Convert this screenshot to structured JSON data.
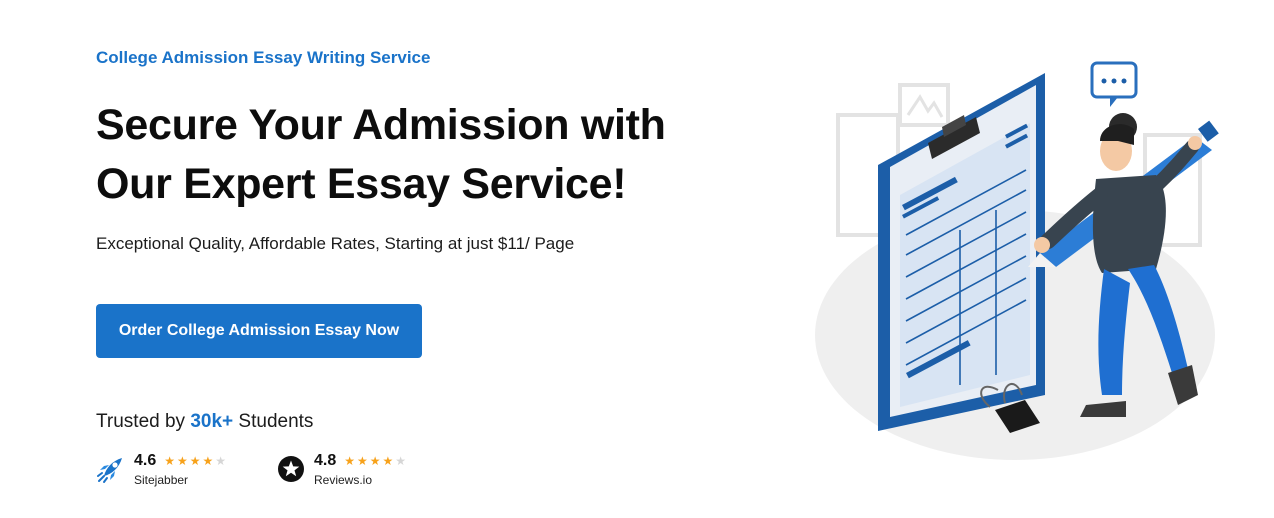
{
  "hero": {
    "eyebrow": "College Admission Essay Writing Service",
    "headline_line1": "Secure Your Admission with",
    "headline_line2": "Our Expert Essay Service!",
    "subtitle": "Exceptional Quality, Affordable Rates, Starting at just $11/ Page",
    "cta_label": "Order College Admission Essay Now"
  },
  "trust": {
    "prefix": "Trusted by ",
    "count": "30k+",
    "suffix": " Students",
    "ratings": [
      {
        "score": "4.6",
        "source": "Sitejabber",
        "stars": "★★★★",
        "stars_off": "★",
        "icon": "rocket-icon"
      },
      {
        "score": "4.8",
        "source": "Reviews.io",
        "stars": "★★★★",
        "stars_off": "★",
        "icon": "star-badge-icon"
      }
    ]
  },
  "colors": {
    "accent": "#1a73c9",
    "star": "#f7a21b",
    "text": "#111111"
  },
  "illustration": {
    "icon": "clipboard-form-person-illustration"
  }
}
